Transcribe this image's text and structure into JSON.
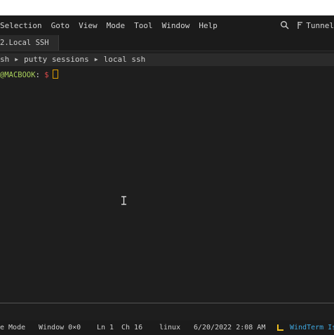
{
  "menu": {
    "items": [
      "Selection",
      "Goto",
      "View",
      "Mode",
      "Tool",
      "Window",
      "Help"
    ],
    "tunnel_label": "Tunnel"
  },
  "tabs": [
    {
      "label": "2.Local SSH"
    }
  ],
  "breadcrumb": {
    "items": [
      "sh",
      "putty sessions",
      "local ssh"
    ]
  },
  "terminal": {
    "prompt_host": "@MACBOOK",
    "prompt_sep": ": ",
    "prompt_dollar": "$"
  },
  "statusbar": {
    "mode": "e Mode",
    "window_size": "Window 0×0",
    "line": "Ln 1",
    "col": "Ch 16",
    "os": "linux",
    "datetime": "6/20/2022 2:08 AM",
    "brand": "WindTerm Is"
  },
  "colors": {
    "accent": "#3fa7e0",
    "prompt_host": "#a9d05b",
    "prompt_dollar": "#e04b4b",
    "cursor": "#e0a000",
    "background": "#1e1e1e"
  },
  "icons": {
    "search": "search-icon",
    "tunnel": "tunnel-icon",
    "breadcrumb_arrow": "chevron-right-icon",
    "text_cursor": "ibeam-cursor-icon",
    "windterm": "windterm-icon"
  }
}
